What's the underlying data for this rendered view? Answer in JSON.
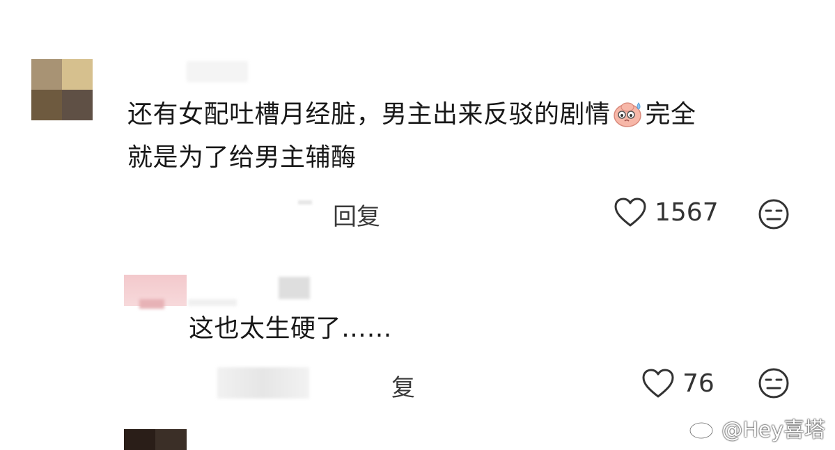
{
  "comments": [
    {
      "text_line1": "还有女配吐槽月经脏，男主出来反驳的剧情",
      "text_line1b": "完全",
      "text_line2": "就是为了给男主辅酶",
      "emoji_icon": "sweating-face-emoji-icon",
      "reply_label": "回复",
      "like_count": "1567"
    },
    {
      "text": "这也太生硬了……",
      "reply_label": "复",
      "like_count": "76"
    }
  ],
  "watermark": {
    "handle": "@Hey喜塔",
    "icon": "weibo-logo-icon"
  },
  "colors": {
    "text": "#181818",
    "icon_stroke": "#333333",
    "background": "#ffffff"
  }
}
